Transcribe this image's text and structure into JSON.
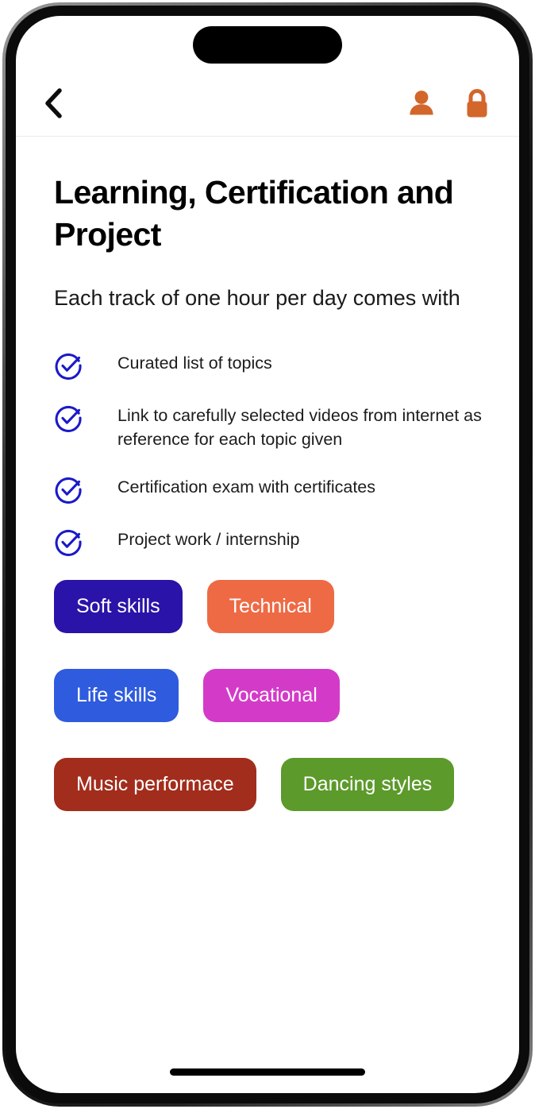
{
  "app_bar": {
    "back_icon": "chevron-left-icon",
    "profile_icon": "person-icon",
    "lock_icon": "lock-icon",
    "icon_color": "#D3662A"
  },
  "page": {
    "title": "Learning, Certification and Project",
    "subtitle": "Each track of one hour per day comes with"
  },
  "features": {
    "check_color": "#1A1AC8",
    "items": [
      {
        "text": "Curated list of topics",
        "icon": "check-circle-icon"
      },
      {
        "text": "Link to carefully selected videos from internet as reference for each topic given",
        "icon": "check-circle-icon"
      },
      {
        "text": "Certification exam with certificates",
        "icon": "check-circle-icon"
      },
      {
        "text": "Project work / internship",
        "icon": "check-circle-icon"
      }
    ]
  },
  "categories": {
    "rows": [
      [
        {
          "label": "Soft skills",
          "color": "#2A13A8"
        },
        {
          "label": "Technical",
          "color": "#EE6A44"
        }
      ],
      [
        {
          "label": "Life skills",
          "color": "#2F5BDE"
        },
        {
          "label": "Vocational",
          "color": "#D43AC8"
        }
      ],
      [
        {
          "label": "Music performace",
          "color": "#A22D1C"
        },
        {
          "label": "Dancing styles",
          "color": "#5C9A2B"
        }
      ]
    ]
  },
  "device": {
    "dynamic_island": "dynamic-island",
    "home_indicator": "home-indicator"
  }
}
